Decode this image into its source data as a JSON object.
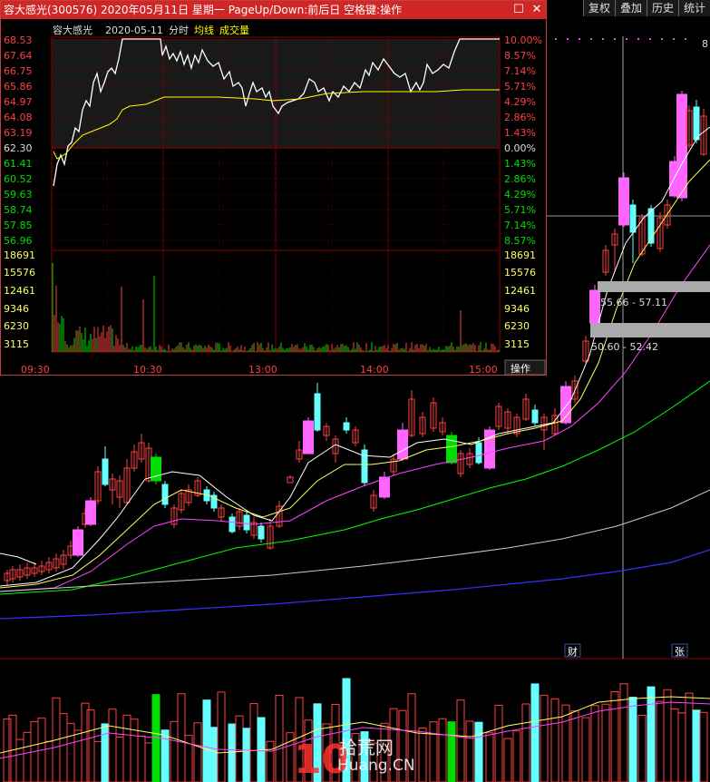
{
  "popup": {
    "title": "容大感光(300576) 2020年05月11日 星期一 PageUp/Down:前后日 空格键:操作",
    "min_icon": "minimize-icon",
    "close_icon": "close-icon",
    "header": {
      "name": "容大感光",
      "date": "2020-05-11",
      "mode": "分时",
      "avg_label": "均线",
      "vol_label": "成交量"
    },
    "price_left": [
      "68.53",
      "67.64",
      "66.75",
      "65.86",
      "64.97",
      "64.08",
      "63.19",
      "62.30",
      "61.41",
      "60.52",
      "59.63",
      "58.74",
      "57.85",
      "56.96"
    ],
    "pct_right": [
      "10.00%",
      "8.57%",
      "7.14%",
      "5.71%",
      "4.29%",
      "2.86%",
      "1.43%",
      "0.00%",
      "1.43%",
      "2.86%",
      "4.29%",
      "5.71%",
      "7.14%",
      "8.57%"
    ],
    "vol_left": [
      "18691",
      "15576",
      "12461",
      "9346",
      "6230",
      "3115"
    ],
    "vol_right": [
      "18691",
      "15576",
      "12461",
      "9346",
      "6230",
      "3115"
    ],
    "times": [
      "09:30",
      "10:30",
      "13:00",
      "14:00",
      "15:00"
    ],
    "action_button": "操作",
    "colors": {
      "price_line": "#ffffff",
      "avg_line": "#ffff00",
      "up": "#ff4040",
      "down": "#00dd00",
      "grid": "#8b0000"
    }
  },
  "toolbar": {
    "buttons": [
      "复权",
      "叠加",
      "历史",
      "统计"
    ]
  },
  "kline": {
    "price_boxes": [
      "55.66 - 57.11",
      "50.60 - 52.42"
    ],
    "top_value": "8",
    "markers": [
      "财",
      "张"
    ],
    "colors": {
      "pink": "#ff66ff",
      "cyan": "#66ffff",
      "red": "#ff4040",
      "green": "#00dd00"
    }
  },
  "watermark": {
    "name": "拾荒网",
    "domain": "Huang.CN",
    "logo": "10"
  }
}
